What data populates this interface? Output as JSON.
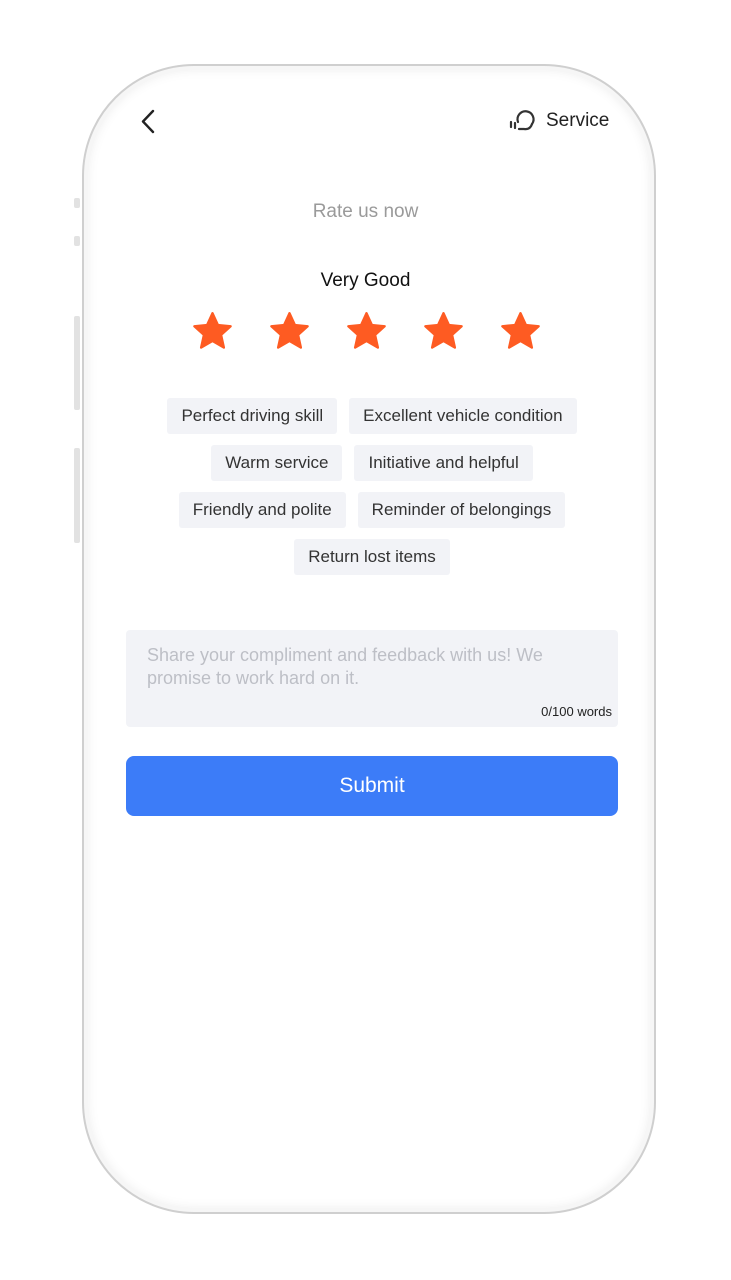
{
  "header": {
    "back_icon": "chevron-left-icon",
    "service_icon": "headset-icon",
    "service_label": "Service"
  },
  "rating": {
    "prompt": "Rate us now",
    "level_label": "Very Good",
    "stars_filled": 5,
    "stars_total": 5,
    "star_color": "#fe5b22"
  },
  "tags": [
    "Perfect driving skill",
    "Excellent vehicle condition",
    "Warm service",
    "Initiative and helpful",
    "Friendly and polite",
    "Reminder of belongings",
    "Return lost items"
  ],
  "feedback": {
    "placeholder": "Share your compliment and feedback with us! We promise to work hard on it.",
    "value": "",
    "counter": "0/100 words"
  },
  "submit_label": "Submit",
  "colors": {
    "accent": "#3c7cf8",
    "chip_bg": "#f2f3f7"
  }
}
